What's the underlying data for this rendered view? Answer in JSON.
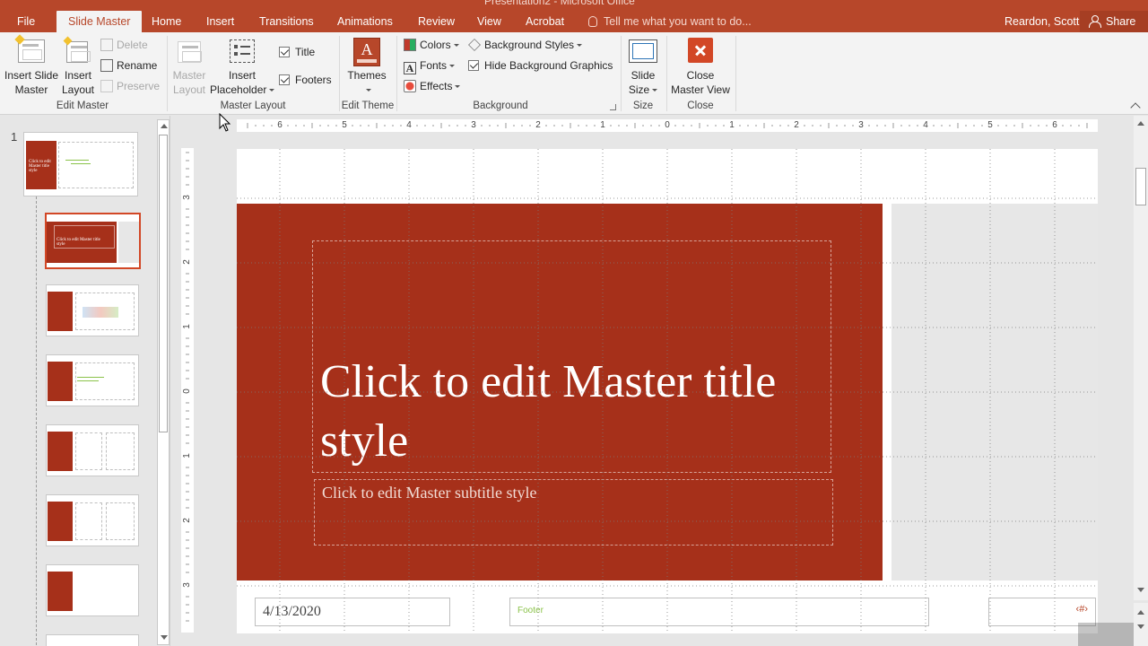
{
  "window": {
    "doc_title": "Presentation2 - Microsoft Office"
  },
  "tabs": [
    {
      "label": "File",
      "active": false
    },
    {
      "label": "Slide Master",
      "active": true
    },
    {
      "label": "Home",
      "active": false
    },
    {
      "label": "Insert",
      "active": false
    },
    {
      "label": "Transitions",
      "active": false
    },
    {
      "label": "Animations",
      "active": false
    },
    {
      "label": "Review",
      "active": false
    },
    {
      "label": "View",
      "active": false
    },
    {
      "label": "Acrobat",
      "active": false
    }
  ],
  "tell_me": "Tell me what you want to do...",
  "user": "Reardon, Scott",
  "share_label": "Share",
  "ribbon": {
    "edit_master": {
      "insert_slide_master": [
        "Insert Slide",
        "Master"
      ],
      "insert_layout": [
        "Insert",
        "Layout"
      ],
      "delete": "Delete",
      "rename": "Rename",
      "preserve": "Preserve",
      "group_label": "Edit Master"
    },
    "master_layout": {
      "master_layout": [
        "Master",
        "Layout"
      ],
      "insert_placeholder": [
        "Insert",
        "Placeholder"
      ],
      "title": "Title",
      "footers": "Footers",
      "title_checked": true,
      "footers_checked": true,
      "group_label": "Master Layout"
    },
    "edit_theme": {
      "themes": "Themes",
      "group_label": "Edit Theme"
    },
    "background": {
      "colors": "Colors",
      "fonts": "Fonts",
      "effects": "Effects",
      "background_styles": "Background Styles",
      "hide_background_graphics": "Hide Background Graphics",
      "hide_checked": true,
      "group_label": "Background"
    },
    "size": {
      "slide_size": [
        "Slide",
        "Size"
      ],
      "group_label": "Size"
    },
    "close": {
      "close_master_view": [
        "Close",
        "Master View"
      ],
      "group_label": "Close"
    }
  },
  "thumbnails": {
    "slide_number": "1",
    "master_title": "Click to edit Master title style",
    "layout_title": "Click to edit Master title style"
  },
  "ruler": {
    "h_labels": [
      "6",
      "5",
      "4",
      "3",
      "2",
      "1",
      "0",
      "1",
      "2",
      "3",
      "4",
      "5",
      "6"
    ],
    "v_labels": [
      "3",
      "2",
      "1",
      "0",
      "1",
      "2",
      "3"
    ]
  },
  "slide": {
    "title": "Click to edit Master title style",
    "subtitle": "Click to edit Master subtitle style",
    "date": "4/13/2020",
    "footer": "Footer",
    "slide_number": "‹#›"
  },
  "colors": {
    "accent": "#b7472a",
    "panel_red": "#a6301a"
  }
}
